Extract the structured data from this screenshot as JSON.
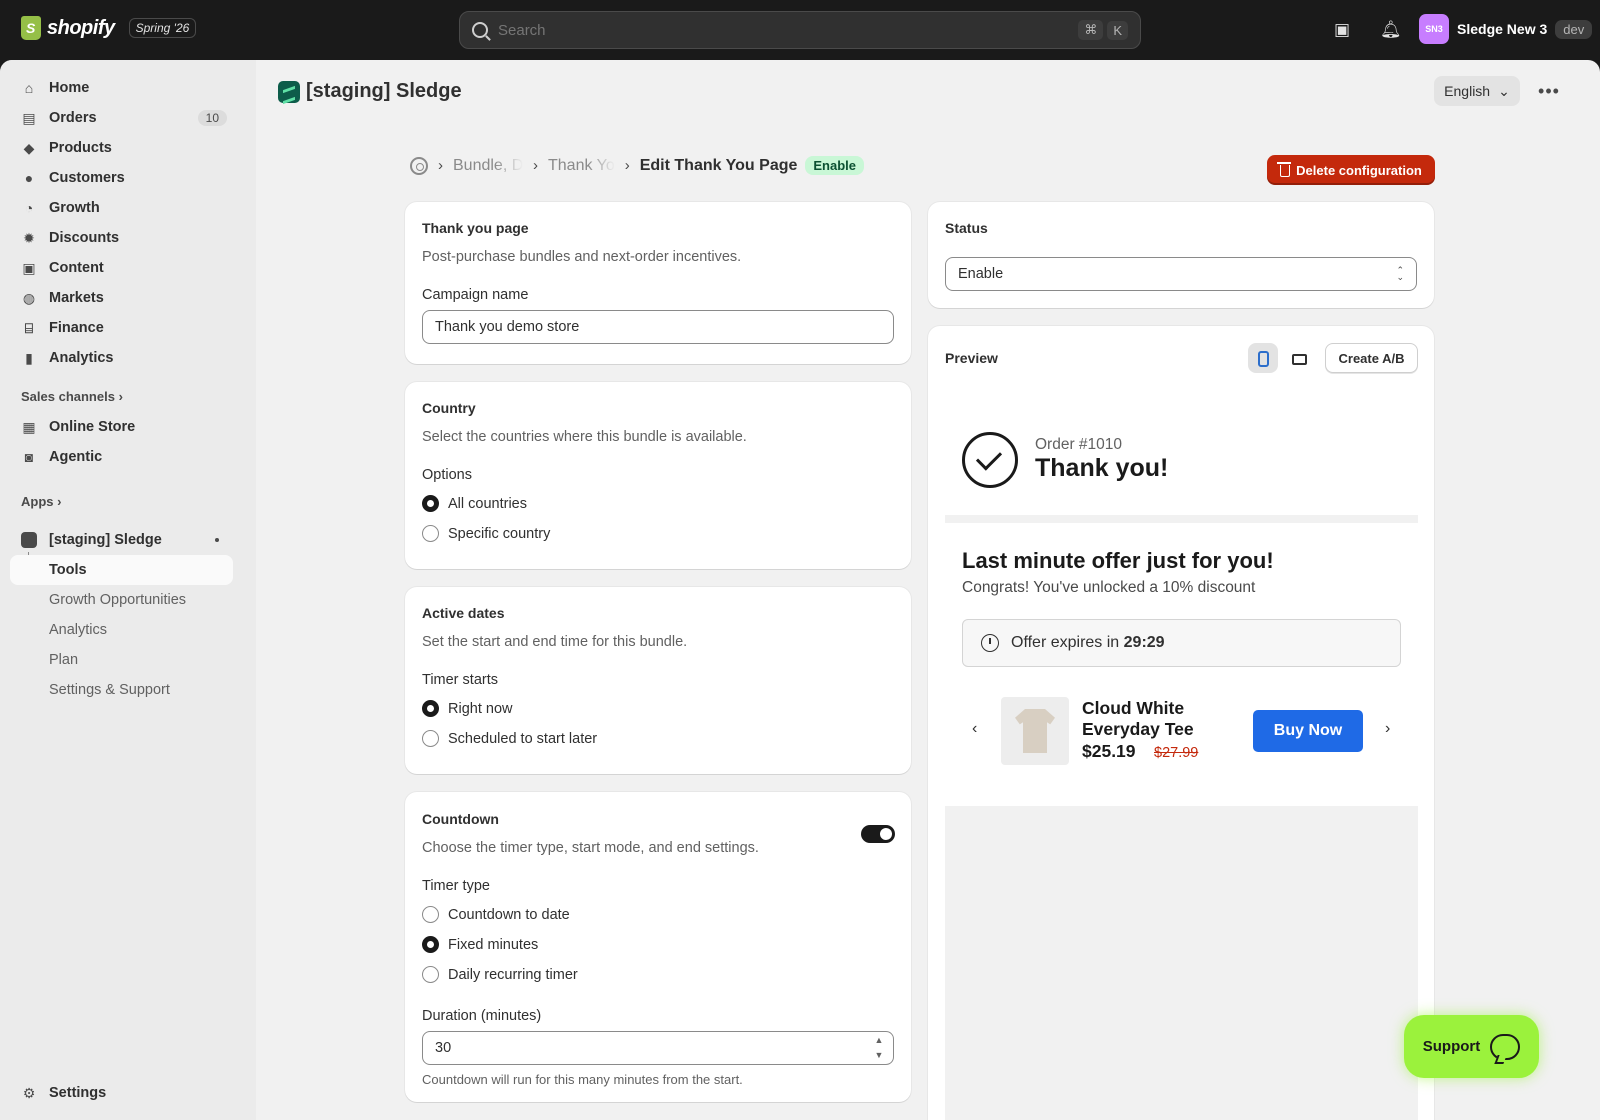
{
  "topbar": {
    "logo_text": "shopify",
    "release_badge": "Spring '26",
    "search_placeholder": "Search",
    "shortcut_cmd": "⌘",
    "shortcut_key": "K",
    "store_avatar_initials": "SN3",
    "store_name": "Sledge New 3",
    "env_badge": "dev"
  },
  "sidebar": {
    "items": [
      {
        "label": "Home",
        "icon": "home-icon"
      },
      {
        "label": "Orders",
        "icon": "orders-icon",
        "count": "10"
      },
      {
        "label": "Products",
        "icon": "tag-icon"
      },
      {
        "label": "Customers",
        "icon": "person-icon"
      },
      {
        "label": "Growth",
        "icon": "growth-icon"
      },
      {
        "label": "Discounts",
        "icon": "discount-icon"
      },
      {
        "label": "Content",
        "icon": "content-icon"
      },
      {
        "label": "Markets",
        "icon": "globe-icon"
      },
      {
        "label": "Finance",
        "icon": "bank-icon"
      },
      {
        "label": "Analytics",
        "icon": "chart-icon"
      }
    ],
    "sales_channels_label": "Sales channels",
    "channels": [
      {
        "label": "Online Store",
        "icon": "store-icon"
      },
      {
        "label": "Agentic",
        "icon": "agentic-icon"
      }
    ],
    "apps_label": "Apps",
    "app_name": "[staging] Sledge",
    "app_subitems": [
      "Tools",
      "Growth Opportunities",
      "Analytics",
      "Plan",
      "Settings & Support"
    ],
    "settings_label": "Settings"
  },
  "header": {
    "title": "[staging] Sledge",
    "language": "English"
  },
  "breadcrumb": {
    "crumb1": "Bundle, D",
    "crumb2": "Thank Yo",
    "current": "Edit Thank You Page",
    "status": "Enable",
    "delete_label": "Delete configuration"
  },
  "thank_you_card": {
    "title": "Thank you page",
    "subtitle": "Post-purchase bundles and next-order incentives.",
    "campaign_label": "Campaign name",
    "campaign_value": "Thank you demo store"
  },
  "country_card": {
    "title": "Country",
    "subtitle": "Select the countries where this bundle is available.",
    "options_label": "Options",
    "options": [
      "All countries",
      "Specific country"
    ],
    "selected": 0
  },
  "dates_card": {
    "title": "Active dates",
    "subtitle": "Set the start and end time for this bundle.",
    "timer_label": "Timer starts",
    "options": [
      "Right now",
      "Scheduled to start later"
    ],
    "selected": 0
  },
  "countdown_card": {
    "title": "Countdown",
    "subtitle": "Choose the timer type, start mode, and end settings.",
    "enabled": true,
    "type_label": "Timer type",
    "options": [
      "Countdown to date",
      "Fixed minutes",
      "Daily recurring timer"
    ],
    "selected": 1,
    "duration_label": "Duration (minutes)",
    "duration_value": "30",
    "help": "Countdown will run for this many minutes from the start."
  },
  "status_card": {
    "title": "Status",
    "value": "Enable"
  },
  "preview_card": {
    "title": "Preview",
    "ab_label": "Create A/B",
    "order_number": "Order #1010",
    "thanks": "Thank you!",
    "offer_title": "Last minute offer just for you!",
    "offer_sub": "Congrats! You've unlocked a 10% discount",
    "timer_text": "Offer expires in",
    "timer_value": "29:29",
    "product_name": "Cloud White Everyday Tee",
    "price": "$25.19",
    "old_price": "$27.99",
    "buy_label": "Buy Now"
  },
  "support": {
    "label": "Support"
  },
  "colors": {
    "accent_primary": "#1f6ae6",
    "danger": "#c4290c",
    "success_bg": "#c9f7d6",
    "support_green": "#9bf23c"
  }
}
